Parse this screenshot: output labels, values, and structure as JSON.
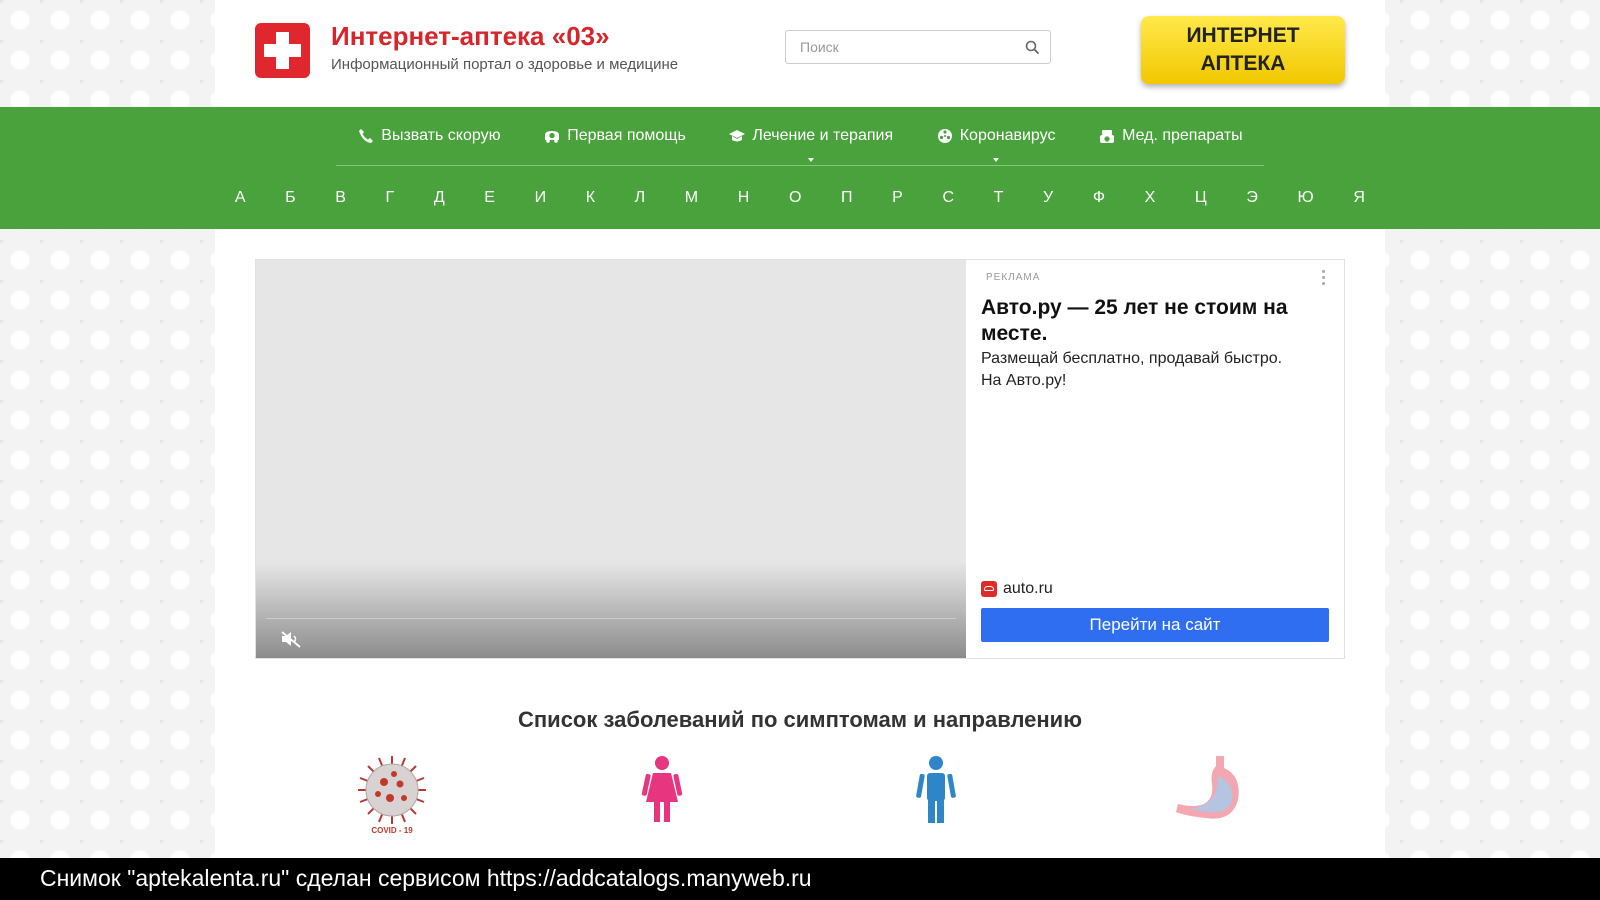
{
  "header": {
    "title": "Интернет-аптека «03»",
    "subtitle": "Информационный портал о здоровье и медицине",
    "search_placeholder": "Поиск",
    "pharmacy_button": "ИНТЕРНЕТ\nАПТЕКА"
  },
  "nav": {
    "items": [
      {
        "label": "Вызвать скорую",
        "icon": "phone-icon"
      },
      {
        "label": "Первая помощь",
        "icon": "ambulance-icon"
      },
      {
        "label": "Лечение и терапия",
        "icon": "graduation-cap-icon",
        "dropdown": true
      },
      {
        "label": "Коронавирус",
        "icon": "virus-icon",
        "dropdown": true
      },
      {
        "label": "Мед. препараты",
        "icon": "pills-icon"
      }
    ],
    "alphabet": [
      "А",
      "Б",
      "В",
      "Г",
      "Д",
      "Е",
      "И",
      "К",
      "Л",
      "М",
      "Н",
      "О",
      "П",
      "Р",
      "С",
      "Т",
      "У",
      "Ф",
      "Х",
      "Ц",
      "Э",
      "Ю",
      "Я"
    ]
  },
  "ad": {
    "label": "РЕКЛАМА",
    "title": "Авто.ру — 25 лет не стоим на месте.",
    "text": "Размещай бесплатно, продавай быстро. На Авто.ру!",
    "brand": "auto.ru",
    "cta": "Перейти на сайт"
  },
  "section": {
    "title": "Список заболеваний по симптомам и направлению",
    "categories": [
      {
        "icon": "covid-virus-icon",
        "caption": "COVID - 19"
      },
      {
        "icon": "female-figure-icon"
      },
      {
        "icon": "male-figure-icon"
      },
      {
        "icon": "stomach-icon"
      }
    ]
  },
  "footer": {
    "text": "Снимок \"aptekalenta.ru\" сделан сервисом https://addcatalogs.manyweb.ru"
  },
  "colors": {
    "brand_red": "#e0272d",
    "nav_green": "#4aa23c",
    "button_yellow": "#f1c800",
    "cta_blue": "#2f6ef0"
  }
}
